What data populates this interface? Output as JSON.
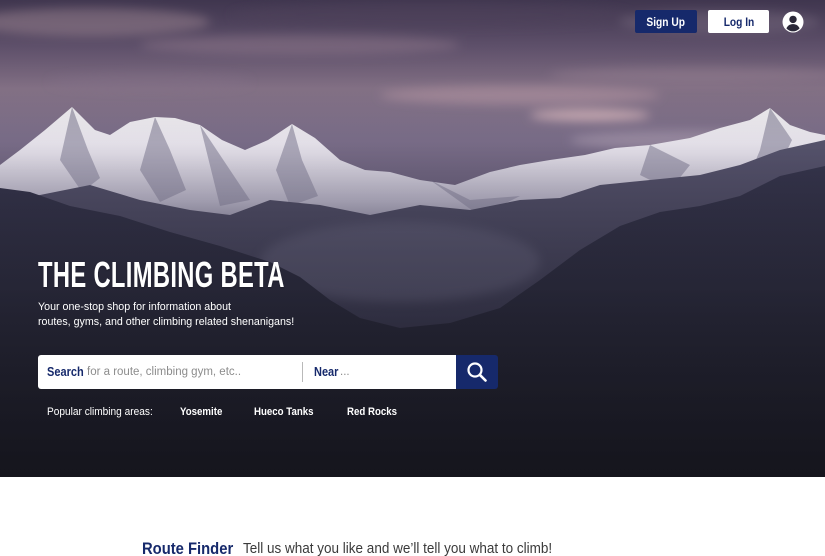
{
  "header": {
    "sign_up_label": "Sign Up",
    "log_in_label": "Log In",
    "avatar_icon": "user-circle-icon"
  },
  "hero": {
    "title": "THE CLIMBING BETA",
    "subtitle_lines": [
      "Your one-stop shop for information about",
      "routes, gyms, and other climbing related shenanigans!"
    ]
  },
  "search": {
    "search_label": "Search",
    "search_placeholder": "for a route, climbing gym, etc..",
    "near_label": "Near",
    "near_placeholder": "...",
    "submit_icon": "search-icon"
  },
  "popular": {
    "label": "Popular climbing areas:",
    "areas": [
      "Yosemite",
      "Hueco Tanks",
      "Red Rocks"
    ]
  },
  "route_finder": {
    "title": "Route Finder",
    "tagline": "Tell us what you like and we’ll tell you what to climb!"
  },
  "colors": {
    "brand_navy": "#16296b",
    "text_dark": "#3a3a3a",
    "placeholder": "#8c8c8c",
    "white": "#ffffff"
  }
}
